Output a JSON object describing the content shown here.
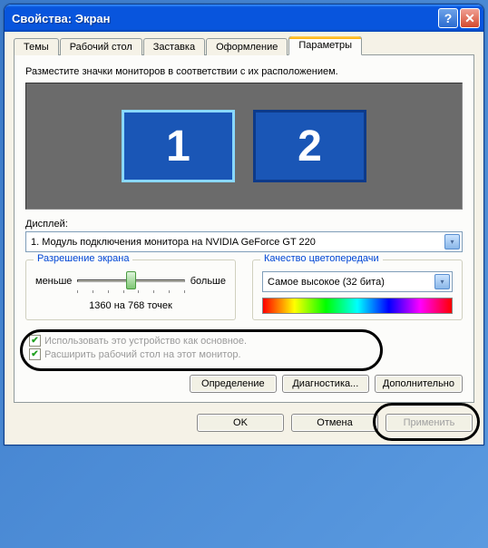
{
  "window": {
    "title": "Свойства: Экран"
  },
  "tabs": {
    "items": [
      {
        "label": "Темы"
      },
      {
        "label": "Рабочий стол"
      },
      {
        "label": "Заставка"
      },
      {
        "label": "Оформление"
      },
      {
        "label": "Параметры"
      }
    ],
    "active_index": 4
  },
  "instruction": "Разместите значки мониторов в соответствии с их расположением.",
  "monitors": {
    "items": [
      {
        "num": "1",
        "selected": true
      },
      {
        "num": "2",
        "selected": false
      }
    ]
  },
  "display": {
    "label": "Дисплей:",
    "value": "1. Модуль подключения монитора на NVIDIA GeForce GT 220"
  },
  "resolution": {
    "group_title": "Разрешение экрана",
    "less": "меньше",
    "more": "больше",
    "text": "1360 на 768 точек"
  },
  "color_quality": {
    "group_title": "Качество цветопередачи",
    "value": "Самое высокое (32 бита)"
  },
  "checks": {
    "primary": "Использовать это устройство как основное.",
    "extend": "Расширить рабочий стол на этот монитор."
  },
  "buttons": {
    "identify": "Определение",
    "troubleshoot": "Диагностика...",
    "advanced": "Дополнительно",
    "ok": "OK",
    "cancel": "Отмена",
    "apply": "Применить"
  }
}
